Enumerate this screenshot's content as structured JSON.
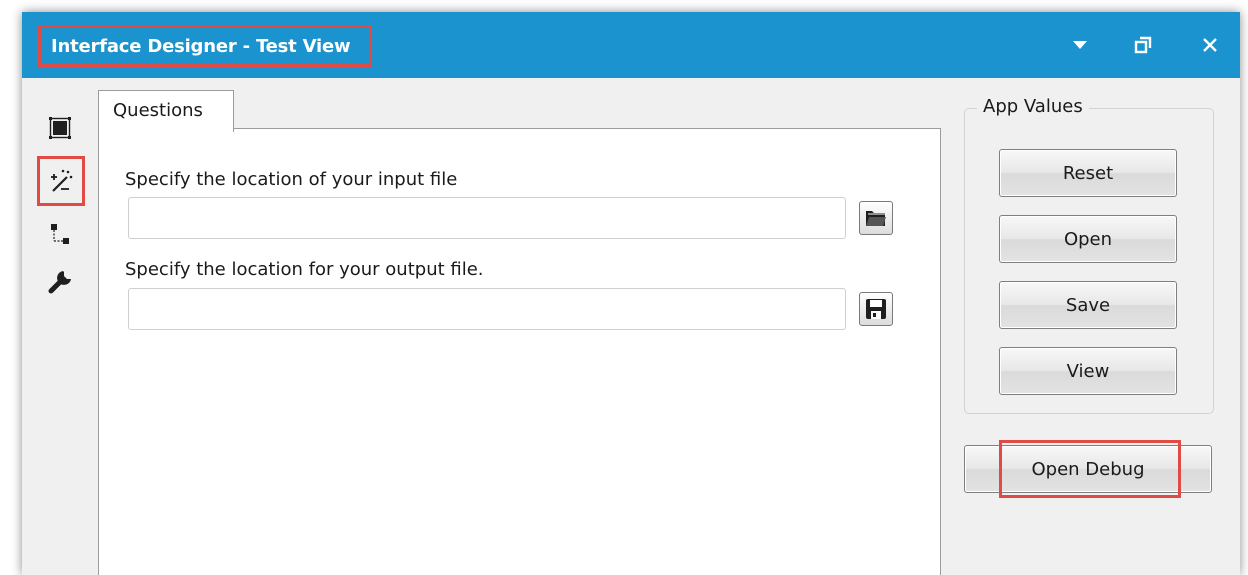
{
  "window": {
    "title": "Interface Designer - Test View",
    "accent_color": "#1a93cf",
    "highlight_color": "#e04b45",
    "controls": [
      "dropdown-arrow-icon",
      "restore-window-icon",
      "close-icon"
    ]
  },
  "toolbar": {
    "items": [
      {
        "icon": "layout-icon",
        "selected": false
      },
      {
        "icon": "magic-wand-icon",
        "selected": true
      },
      {
        "icon": "tree-connector-icon",
        "selected": false
      },
      {
        "icon": "wrench-icon",
        "selected": false
      }
    ]
  },
  "tabs": [
    {
      "label": "Questions",
      "active": true
    }
  ],
  "questions": [
    {
      "label": "Specify the location of your input file",
      "value": "",
      "browse_icon": "open-folder-icon"
    },
    {
      "label": "Specify the location for your output file.",
      "value": "",
      "browse_icon": "save-disk-icon"
    }
  ],
  "app_values": {
    "legend": "App Values",
    "buttons": [
      "Reset",
      "Open",
      "Save",
      "View"
    ]
  },
  "debug_button_label": "Open Debug"
}
